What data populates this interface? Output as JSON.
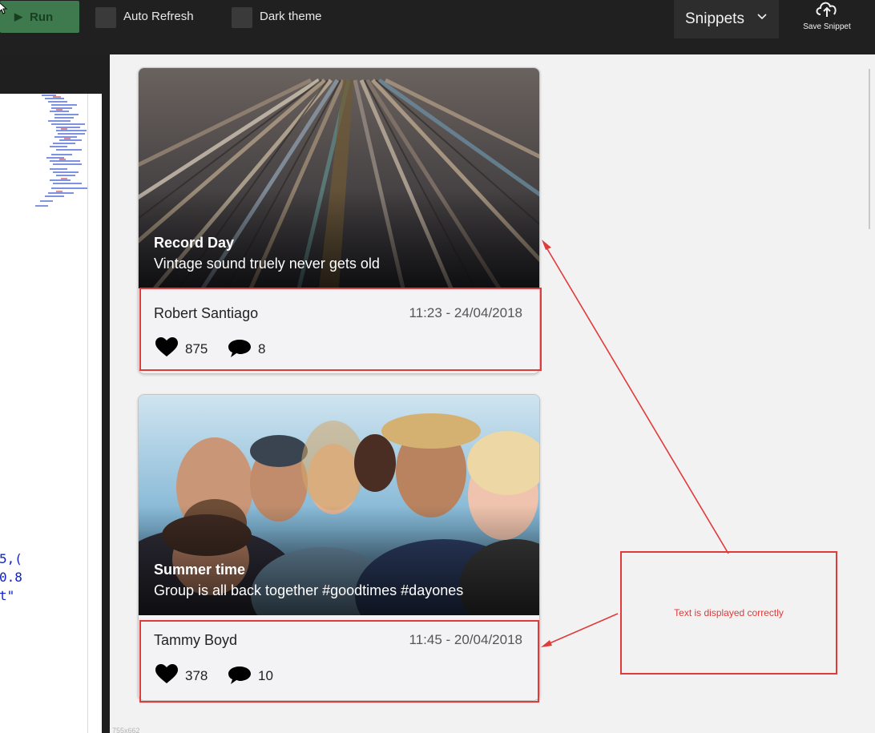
{
  "toolbar": {
    "run_label": "Run",
    "auto_refresh_label": "Auto Refresh",
    "dark_theme_label": "Dark theme",
    "snippets_label": "Snippets",
    "save_snippet_label": "Save Snippet"
  },
  "editor": {
    "code_fragments": [
      "5,(",
      "0.8",
      "t\""
    ]
  },
  "preview": {
    "size_label": "755x662",
    "cards": [
      {
        "title": "Record Day",
        "subtitle": "Vintage sound truely never gets old",
        "author": "Robert Santiago",
        "timestamp": "11:23 - 24/04/2018",
        "likes": "875",
        "comments": "8"
      },
      {
        "title": "Summer time",
        "subtitle": "Group is all back together #goodtimes #dayones",
        "author": "Tammy Boyd",
        "timestamp": "11:45 - 20/04/2018",
        "likes": "378",
        "comments": "10"
      }
    ]
  },
  "annotation": {
    "note_text": "Text is displayed correctly",
    "color": "#e03a3a"
  },
  "colors": {
    "run_button": "#3e7a4e",
    "toolbar_bg": "#202020",
    "preview_bg": "#f2f2f2"
  }
}
